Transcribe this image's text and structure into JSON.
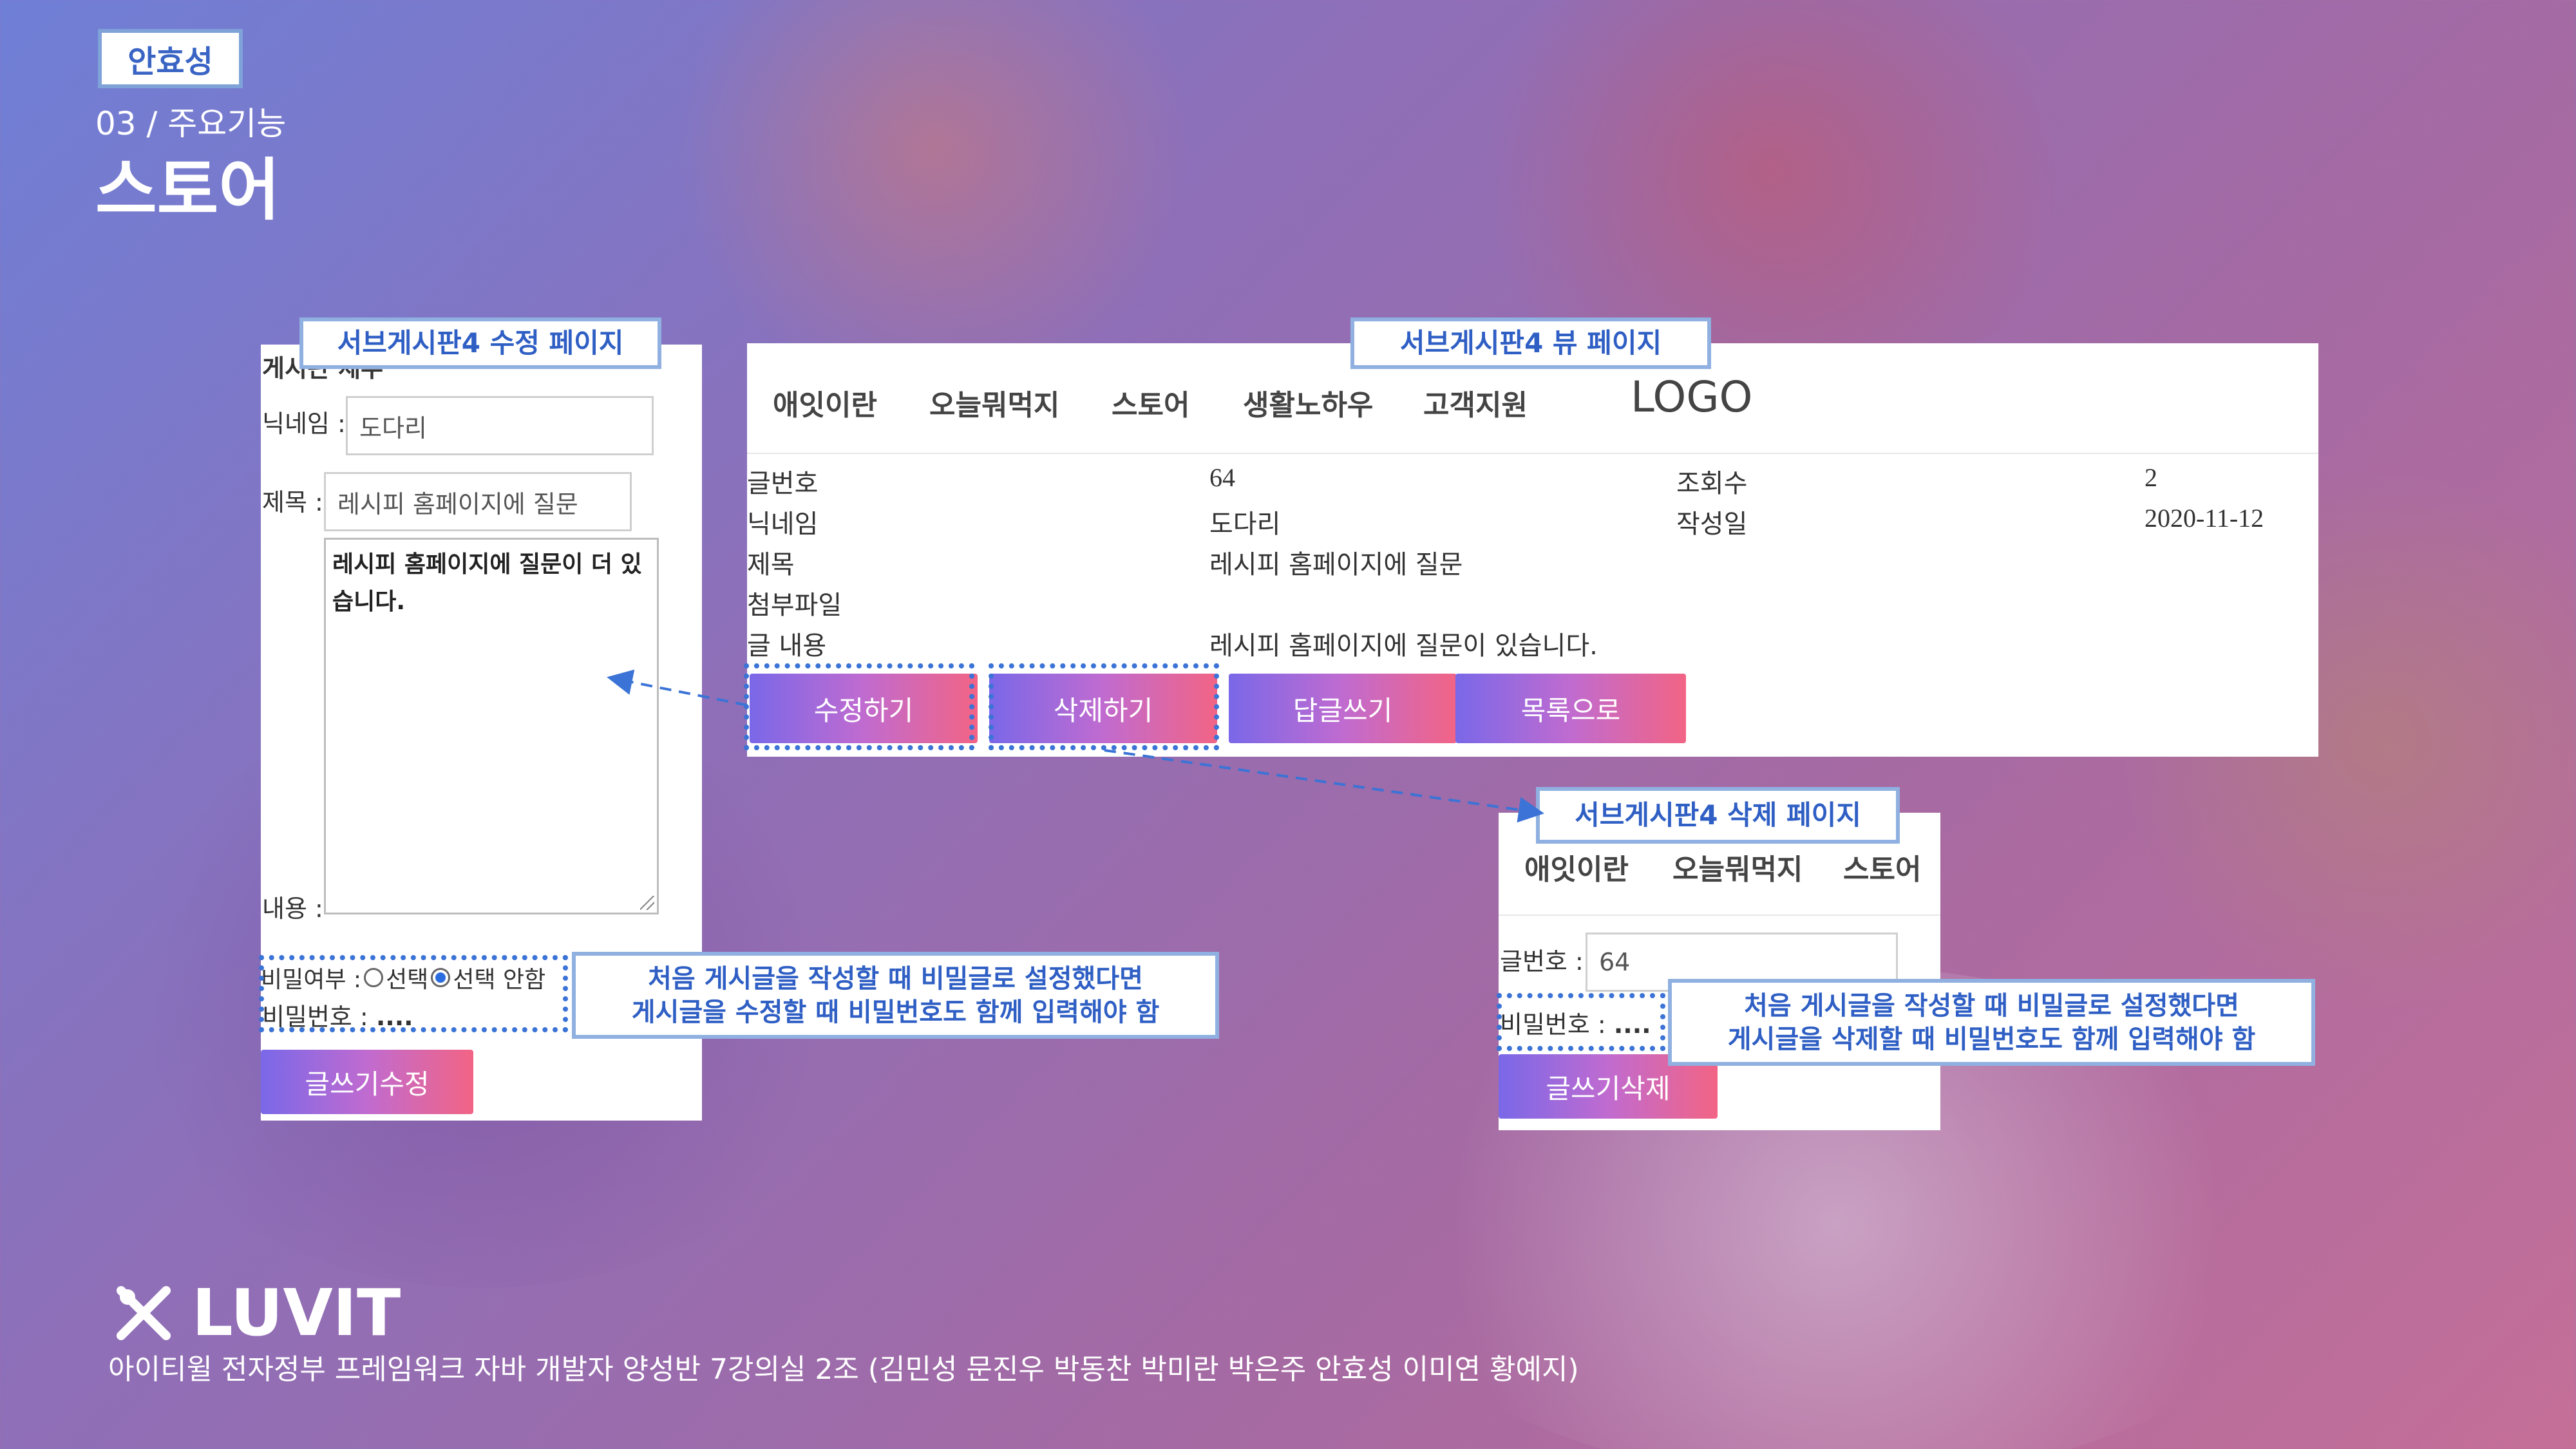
{
  "header": {
    "presenter_tag": "안효성",
    "section_sub": "03 / 주요기능",
    "section_title": "스토어"
  },
  "edit_panel": {
    "callout": "서브게시판4 수정 페이지",
    "partial_heading": "게시판 세부",
    "nickname_label": "닉네임 :",
    "nickname_value": "도다리",
    "title_label": "제목 :",
    "title_value": "레시피 홈페이지에 질문",
    "content_text": "레시피 홈페이지에 질문이 더 있습니다.",
    "content_label": "내용 :",
    "secret_label": "비밀여부 :",
    "secret_option_select": "선택",
    "secret_option_none": "선택 안함",
    "password_label": "비밀번호 :",
    "password_value": "....",
    "submit_label": "글쓰기수정",
    "note_line1": "처음 게시글을 작성할 때 비밀글로 설정했다면",
    "note_line2": "게시글을 수정할 때 비밀번호도 함께 입력해야 함"
  },
  "view_panel": {
    "callout": "서브게시판4 뷰 페이지",
    "nav": [
      "애잇이란",
      "오늘뭐먹지",
      "스토어",
      "생활노하우",
      "고객지원"
    ],
    "logo": "LOGO",
    "post_no_label": "글번호",
    "post_no_value": "64",
    "views_label": "조회수",
    "views_value": "2",
    "nickname_label": "닉네임",
    "nickname_value": "도다리",
    "date_label": "작성일",
    "date_value": "2020-11-12",
    "title_label": "제목",
    "title_value": "레시피 홈페이지에 질문",
    "attach_label": "첨부파일",
    "content_label": "글 내용",
    "content_value": "레시피 홈페이지에 질문이 있습니다.",
    "buttons": [
      "수정하기",
      "삭제하기",
      "답글쓰기",
      "목록으로"
    ]
  },
  "delete_panel": {
    "callout": "서브게시판4 삭제 페이지",
    "nav": [
      "애잇이란",
      "오늘뭐먹지",
      "스토어"
    ],
    "post_no_label": "글번호 :",
    "post_no_value": "64",
    "password_label": "비밀번호 :",
    "password_value": "....",
    "submit_label": "글쓰기삭제",
    "note_line1": "처음 게시글을 작성할 때 비밀글로 설정했다면",
    "note_line2": "게시글을 삭제할 때 비밀번호도 함께 입력해야 함"
  },
  "footer": {
    "brand": "LUVIT",
    "credits": "아이티윌 전자정부 프레임워크 자바 개발자 양성반 7강의실 2조 (김민성 문진우 박동찬 박미란 박은주 안효성 이미연 황예지)"
  },
  "colors": {
    "accent_blue": "#3b73d6",
    "callout_border": "#8fb0e0",
    "button_gradient_start": "#7a68e8",
    "button_gradient_end": "#f26485"
  }
}
